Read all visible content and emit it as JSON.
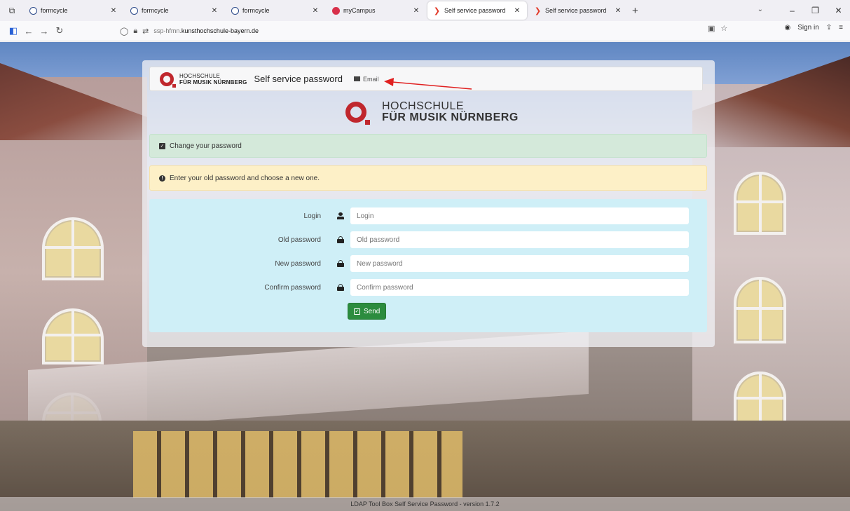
{
  "browser": {
    "tabs": [
      {
        "title": "formcycle",
        "favicon": "formcycle-icon",
        "active": false
      },
      {
        "title": "formcycle",
        "favicon": "formcycle-icon",
        "active": false
      },
      {
        "title": "formcycle",
        "favicon": "formcycle-icon",
        "active": false
      },
      {
        "title": "myCampus",
        "favicon": "mycampus-icon",
        "active": false
      },
      {
        "title": "Self service password",
        "favicon": "ssp-icon",
        "active": true
      },
      {
        "title": "Self service password",
        "favicon": "ssp-icon",
        "active": false
      }
    ],
    "url_subdomain": "ssp-hfmn.",
    "url_domain": "kunsthochschule-bayern.de",
    "sign_in_label": "Sign in"
  },
  "page": {
    "topnav": {
      "logo_line1": "HOCHSCHULE",
      "logo_line2": "FÜR MUSIK NÜRNBERG",
      "brand": "Self service password",
      "email_link": "Email"
    },
    "big_logo": {
      "line1": "HOCHSCHULE",
      "line2": "FÜR MUSIK NÜRNBERG"
    },
    "alert_success": "Change your password",
    "alert_warning": "Enter your old password and choose a new one.",
    "form": {
      "fields": [
        {
          "label": "Login",
          "placeholder": "Login",
          "icon": "user-icon"
        },
        {
          "label": "Old password",
          "placeholder": "Old password",
          "icon": "lock-icon"
        },
        {
          "label": "New password",
          "placeholder": "New password",
          "icon": "lock-icon"
        },
        {
          "label": "Confirm password",
          "placeholder": "Confirm password",
          "icon": "lock-icon"
        }
      ],
      "submit_label": "Send"
    },
    "footer": "LDAP Tool Box Self Service Password - version 1.7.2",
    "colors": {
      "accent_red": "#c0272d",
      "success_bg": "#d4e9da",
      "warning_bg": "#fdf0c7",
      "form_bg": "#cfeff7",
      "button_green": "#2c8c3e",
      "annotation_arrow": "#e02020"
    }
  }
}
